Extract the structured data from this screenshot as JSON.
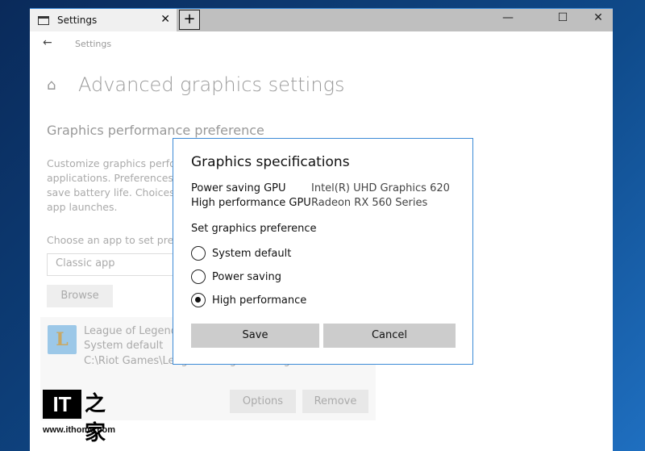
{
  "window": {
    "tab_title": "Settings",
    "new_tab": "+",
    "minimize": "—",
    "maximize": "☐",
    "close": "✕"
  },
  "nav": {
    "back": "←",
    "breadcrumb": "Settings"
  },
  "page": {
    "title": "Advanced graphics settings",
    "section": "Graphics performance preference",
    "description": [
      "Customize graphics perfor",
      "applications. Preferences r",
      "save battery life. Choices r",
      "app launches."
    ],
    "choose_label": "Choose an app to set pref",
    "app_type": "Classic app",
    "browse": "Browse"
  },
  "app": {
    "name": "League of Legends",
    "preference": "System default",
    "path": "C:\\Riot Games\\League of Legends\\League",
    "options": "Options",
    "remove": "Remove",
    "icon_letter": "L"
  },
  "dialog": {
    "title": "Graphics specifications",
    "specs": [
      {
        "label": "Power saving GPU",
        "value": "Intel(R) UHD Graphics 620"
      },
      {
        "label": "High performance GPU",
        "value": "Radeon RX 560 Series"
      }
    ],
    "pref_label": "Set graphics preference",
    "options": [
      {
        "label": "System default",
        "selected": false
      },
      {
        "label": "Power saving",
        "selected": false
      },
      {
        "label": "High performance",
        "selected": true
      }
    ],
    "save": "Save",
    "cancel": "Cancel"
  },
  "watermark": {
    "logo": "IT",
    "logo_zh": "之家",
    "url": "www.ithome.com"
  }
}
